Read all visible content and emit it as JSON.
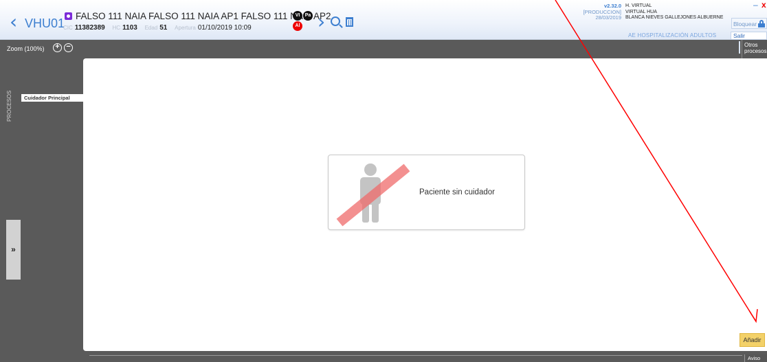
{
  "header": {
    "room": "VHU01",
    "patient_name": "FALSO 111 NAIA FALSO 111 NAIA AP1 FALSO 111 NAIA AP2",
    "cic_label": "CIC",
    "cic": "11382389",
    "hc_label": "HC",
    "hc": "1103",
    "age_label": "Edad",
    "age": "51",
    "opening_label": "Apertura",
    "opening": "01/10/2019 10:09",
    "badges": {
      "vi": "VI",
      "pa": "Pa",
      "al": "Al"
    }
  },
  "system": {
    "version": "v2.32.0",
    "environment": "[PRODUCCION]",
    "date": "28/03/2019",
    "hospital": "H. VIRTUAL",
    "unit": "VIRTUAL HUA",
    "user": "BLANCA NIEVES GALLEJONES ALBUERNE",
    "service": "AE HOSPITALIZACIÓN ADULTOS",
    "lock_label": "Bloquear",
    "exit_label": "Salir Paciente",
    "minimize": "–",
    "close": "x"
  },
  "toolbar": {
    "zoom_label": "Zoom (100%)",
    "zoom_in": "+",
    "zoom_out": "−",
    "other_processes": "Otros procesos"
  },
  "sidebar": {
    "processes_tab": "PROCESOS",
    "active_tab": "Cuidador Principal",
    "expand": "»"
  },
  "main": {
    "empty_message": "Paciente sin cuidador",
    "add_button": "Añadir"
  },
  "footer": {
    "warnings_tab": "Aviso"
  },
  "colors": {
    "accent": "#3d7fd0",
    "dark_bg": "#5a5a5a",
    "add_button": "#f3d169",
    "annotation_arrow": "#ff0000"
  },
  "icons": [
    "back-arrow-icon",
    "forward-arrow-icon",
    "search-icon",
    "trash-icon",
    "lock-icon",
    "zoom-in-icon",
    "zoom-out-icon",
    "person-icon",
    "expand-icon"
  ]
}
